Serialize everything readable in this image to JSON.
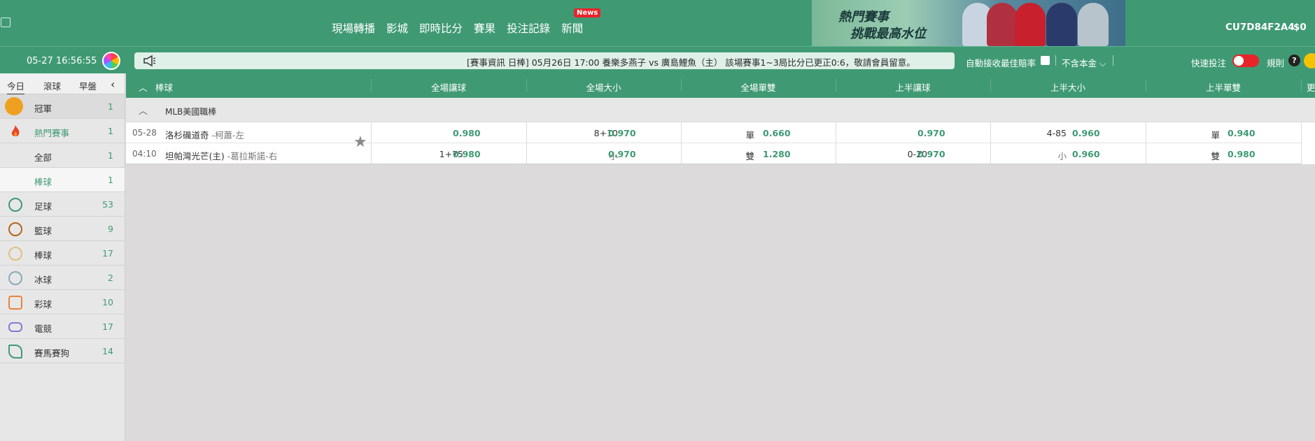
{
  "topnav": {
    "items": [
      "現場轉播",
      "影城",
      "即時比分",
      "賽果",
      "投注記錄",
      "新聞"
    ],
    "news_badge": "News"
  },
  "banner": {
    "line1": "熱門賽事",
    "line2": "挑戰最高水位"
  },
  "account": {
    "id": "CU7D84F2A4",
    "balance": "$0"
  },
  "infobar": {
    "date": "05-27",
    "time": "16:56:55",
    "marquee": "[賽事資訊 日棒] 05月26日 17:00 養樂多燕子 vs 廣島鯉魚（主） 該場賽事1~3局比分已更正0:6，敬請會員留意。",
    "auto_accept": "自動接收最佳賠率",
    "no_capital": "不含本金",
    "fast_bet": "快速投注",
    "rules": "規則"
  },
  "sidebar": {
    "tabs": [
      "今日",
      "滾球",
      "早盤"
    ],
    "items": [
      {
        "label": "冠軍",
        "count": "1",
        "icon": "trophy-icon",
        "color": "#f0a020"
      },
      {
        "label": "熱門賽事",
        "count": "1",
        "icon": "fire-icon",
        "color": "#e8432b"
      },
      {
        "label": "全部",
        "count": "1",
        "icon": "",
        "color": ""
      },
      {
        "label": "棒球",
        "count": "1",
        "icon": "",
        "color": ""
      },
      {
        "label": "足球",
        "count": "53",
        "icon": "soccer-icon",
        "color": "#3f9a74"
      },
      {
        "label": "籃球",
        "count": "9",
        "icon": "basketball-icon",
        "color": "#b5651d"
      },
      {
        "label": "棒球",
        "count": "17",
        "icon": "baseball-icon",
        "color": "#e0c080"
      },
      {
        "label": "冰球",
        "count": "2",
        "icon": "hockey-icon",
        "color": "#7aa"
      },
      {
        "label": "彩球",
        "count": "10",
        "icon": "lottery-icon",
        "color": "#e8843b"
      },
      {
        "label": "電競",
        "count": "17",
        "icon": "esports-icon",
        "color": "#7c7cd0"
      },
      {
        "label": "賽馬賽狗",
        "count": "14",
        "icon": "horse-icon",
        "color": "#3f9a74"
      }
    ]
  },
  "table": {
    "sport": "棒球",
    "columns": [
      "全場讓球",
      "全場大小",
      "全場單雙",
      "上半讓球",
      "上半大小",
      "上半單雙",
      "更"
    ],
    "league": "MLB美國職棒"
  },
  "match": {
    "date": "05-28",
    "time": "04:10",
    "home": "洛杉磯道奇",
    "home_pitcher": " -柯蕭-左",
    "away": "坦帕灣光芒(主)",
    "away_pitcher": " -葛拉斯諾-右",
    "row1": [
      {
        "hc": "",
        "odds": "0.980"
      },
      {
        "hc": "8+10",
        "odds": "0.970"
      },
      {
        "hc": "單",
        "odds": "0.660"
      },
      {
        "hc": "",
        "odds": "0.970"
      },
      {
        "hc": "4-85",
        "odds": "0.960"
      },
      {
        "hc": "單",
        "odds": "0.940"
      }
    ],
    "row2": [
      {
        "hc": "1+75",
        "odds": "0.980"
      },
      {
        "hc": "小",
        "odds": "0.970"
      },
      {
        "hc": "雙",
        "odds": "1.280"
      },
      {
        "hc": "0-20",
        "odds": "0.970"
      },
      {
        "hc": "小",
        "odds": "0.960"
      },
      {
        "hc": "雙",
        "odds": "0.980"
      }
    ]
  }
}
